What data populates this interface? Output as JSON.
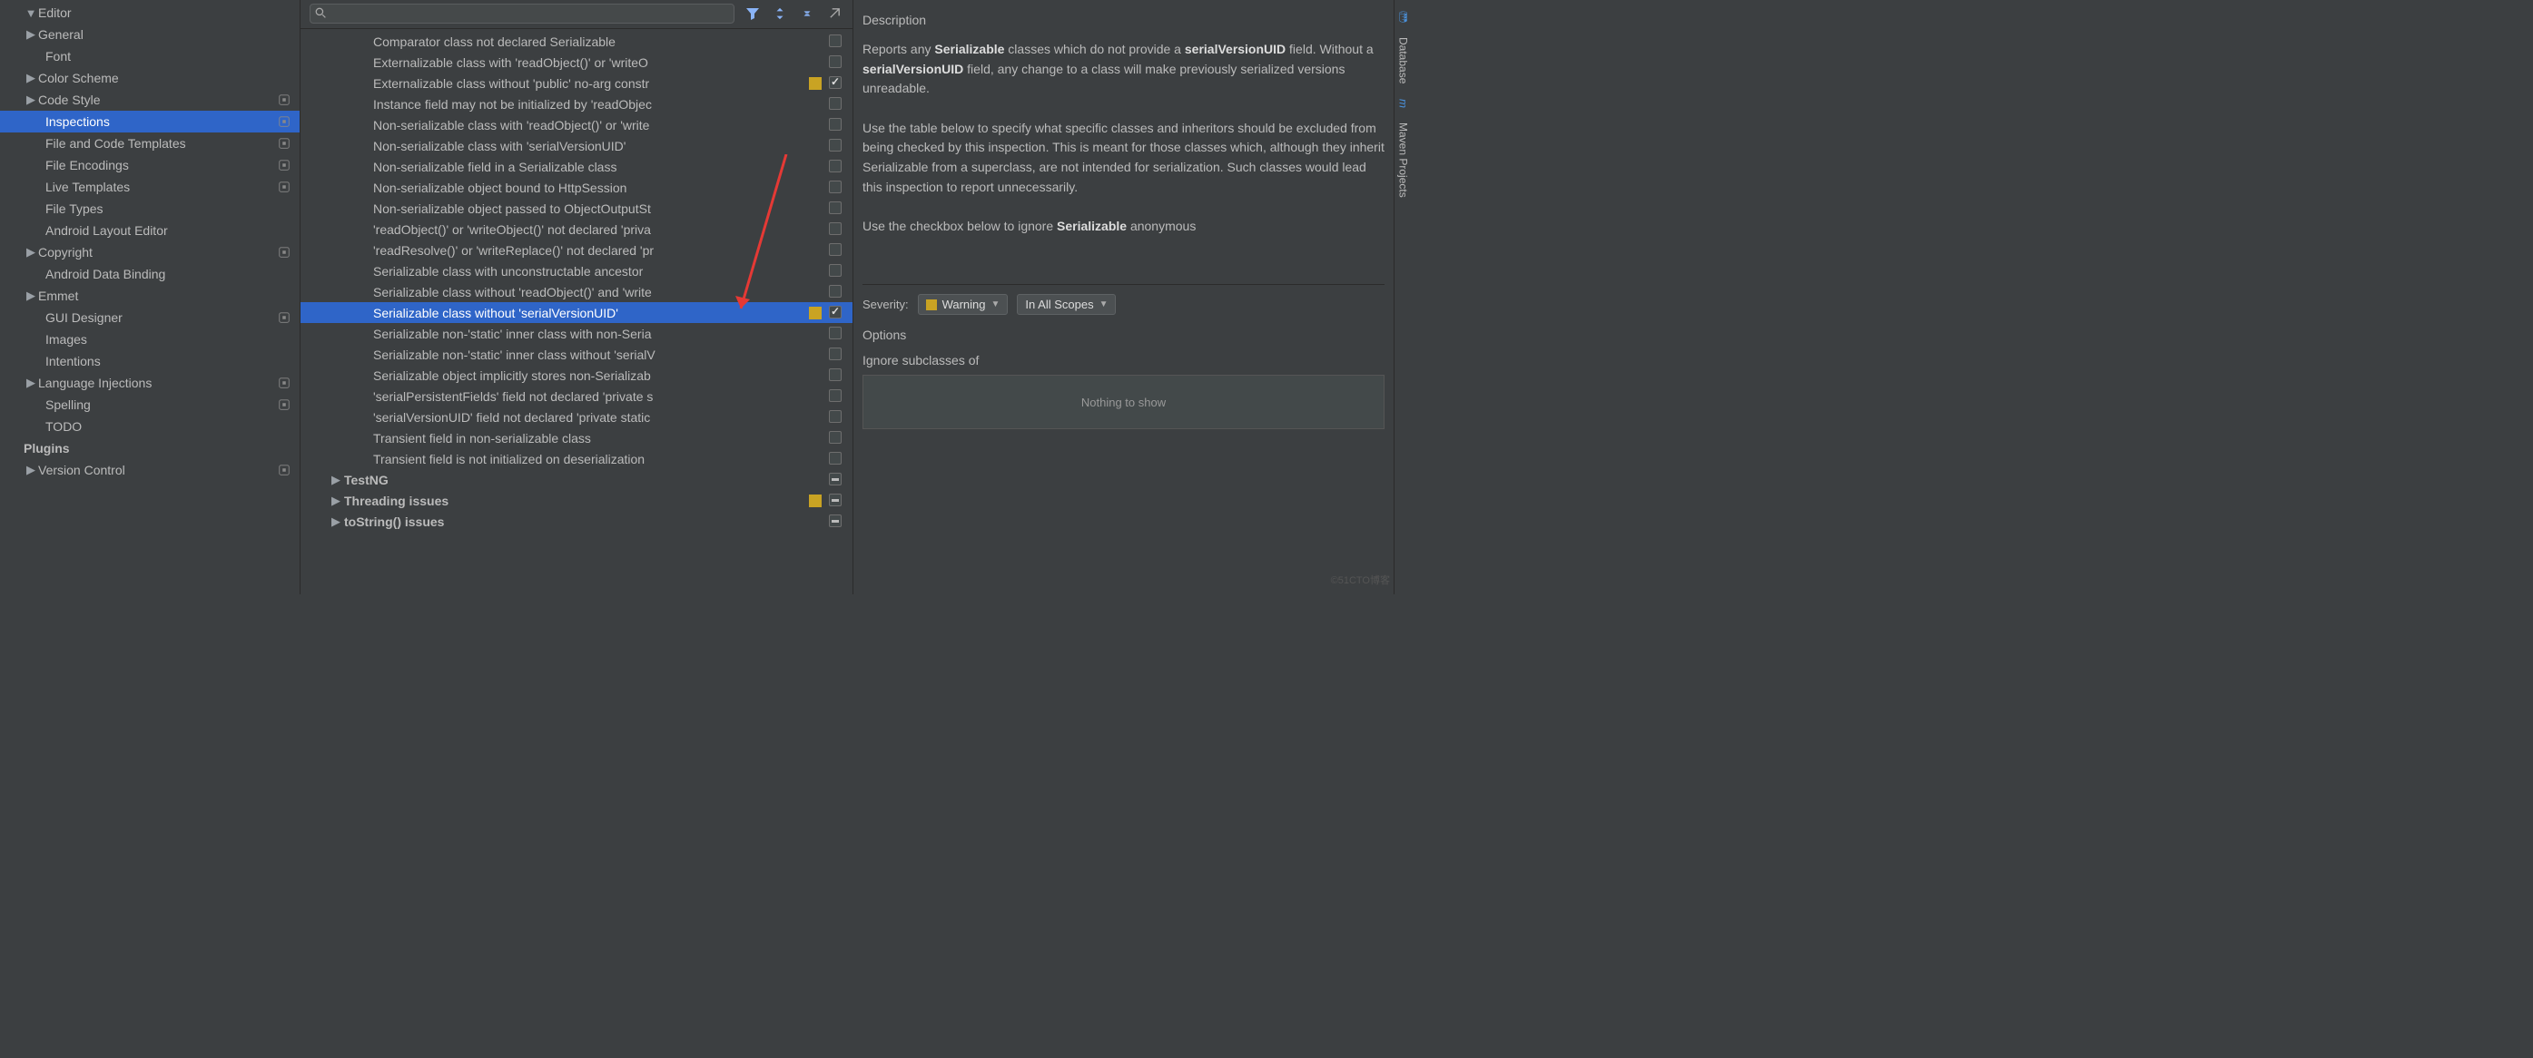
{
  "sidebar": {
    "items": [
      {
        "label": "Editor",
        "expanded": true,
        "indent": 0,
        "arrow": "▼",
        "gear": false
      },
      {
        "label": "General",
        "indent": 0,
        "arrow": "▶",
        "gear": false
      },
      {
        "label": "Font",
        "indent": 1,
        "arrow": "",
        "gear": false
      },
      {
        "label": "Color Scheme",
        "indent": 0,
        "arrow": "▶",
        "gear": false
      },
      {
        "label": "Code Style",
        "indent": 0,
        "arrow": "▶",
        "gear": true
      },
      {
        "label": "Inspections",
        "indent": 1,
        "arrow": "",
        "gear": true,
        "selected": true
      },
      {
        "label": "File and Code Templates",
        "indent": 1,
        "arrow": "",
        "gear": true
      },
      {
        "label": "File Encodings",
        "indent": 1,
        "arrow": "",
        "gear": true
      },
      {
        "label": "Live Templates",
        "indent": 1,
        "arrow": "",
        "gear": true
      },
      {
        "label": "File Types",
        "indent": 1,
        "arrow": "",
        "gear": false
      },
      {
        "label": "Android Layout Editor",
        "indent": 1,
        "arrow": "",
        "gear": false
      },
      {
        "label": "Copyright",
        "indent": 0,
        "arrow": "▶",
        "gear": true
      },
      {
        "label": "Android Data Binding",
        "indent": 1,
        "arrow": "",
        "gear": false
      },
      {
        "label": "Emmet",
        "indent": 0,
        "arrow": "▶",
        "gear": false
      },
      {
        "label": "GUI Designer",
        "indent": 1,
        "arrow": "",
        "gear": true
      },
      {
        "label": "Images",
        "indent": 1,
        "arrow": "",
        "gear": false
      },
      {
        "label": "Intentions",
        "indent": 1,
        "arrow": "",
        "gear": false
      },
      {
        "label": "Language Injections",
        "indent": 0,
        "arrow": "▶",
        "gear": true
      },
      {
        "label": "Spelling",
        "indent": 1,
        "arrow": "",
        "gear": true
      },
      {
        "label": "TODO",
        "indent": 1,
        "arrow": "",
        "gear": false
      },
      {
        "label": "Plugins",
        "indent": 0,
        "arrow": "",
        "gear": false,
        "bold": true
      },
      {
        "label": "Version Control",
        "indent": 0,
        "arrow": "▶",
        "gear": true
      }
    ]
  },
  "tree": {
    "inspections": [
      {
        "label": "Comparator class not declared Serializable",
        "cb": false
      },
      {
        "label": "Externalizable class with 'readObject()' or 'writeO",
        "cb": false
      },
      {
        "label": "Externalizable class without 'public' no-arg constr",
        "cb": true,
        "warn": true
      },
      {
        "label": "Instance field may not be initialized by 'readObjec",
        "cb": false
      },
      {
        "label": "Non-serializable class with 'readObject()' or 'write",
        "cb": false
      },
      {
        "label": "Non-serializable class with 'serialVersionUID'",
        "cb": false
      },
      {
        "label": "Non-serializable field in a Serializable class",
        "cb": false
      },
      {
        "label": "Non-serializable object bound to HttpSession",
        "cb": false
      },
      {
        "label": "Non-serializable object passed to ObjectOutputSt",
        "cb": false
      },
      {
        "label": "'readObject()' or 'writeObject()' not declared 'priva",
        "cb": false
      },
      {
        "label": "'readResolve()' or 'writeReplace()' not declared 'pr",
        "cb": false
      },
      {
        "label": "Serializable class with unconstructable ancestor",
        "cb": false
      },
      {
        "label": "Serializable class without 'readObject()' and 'write",
        "cb": false
      },
      {
        "label": "Serializable class without 'serialVersionUID'",
        "cb": true,
        "warn": true,
        "selected": true
      },
      {
        "label": "Serializable non-'static' inner class with non-Seria",
        "cb": false
      },
      {
        "label": "Serializable non-'static' inner class without 'serialV",
        "cb": false
      },
      {
        "label": "Serializable object implicitly stores non-Serializab",
        "cb": false
      },
      {
        "label": "'serialPersistentFields' field not declared 'private s",
        "cb": false
      },
      {
        "label": "'serialVersionUID' field not declared 'private static",
        "cb": false
      },
      {
        "label": "Transient field in non-serializable class",
        "cb": false
      },
      {
        "label": "Transient field is not initialized on deserialization",
        "cb": false
      }
    ],
    "groups": [
      {
        "label": "TestNG",
        "arrow": "▶",
        "mixed": true
      },
      {
        "label": "Threading issues",
        "arrow": "▶",
        "mixed": true,
        "warn": true
      },
      {
        "label": "toString() issues",
        "arrow": "▶",
        "mixed": true
      }
    ]
  },
  "desc": {
    "title": "Description",
    "p1_a": "Reports any ",
    "p1_b": "Serializable",
    "p1_c": " classes which do not provide a ",
    "p1_d": "serialVersionUID",
    "p1_e": " field. Without a ",
    "p1_f": "serialVersionUID",
    "p1_g": " field, any change to a class will make previously serialized versions unreadable.",
    "p2": "Use the table below to specify what specific classes and inheritors should be excluded from being checked by this inspection. This is meant for those classes which, although they inherit Serializable from a superclass, are not intended for serialization. Such classes would lead this inspection to report unnecessarily.",
    "p3_a": "Use the checkbox below to ignore ",
    "p3_b": "Serializable",
    "p3_c": " anonymous"
  },
  "severity": {
    "label": "Severity:",
    "value": "Warning",
    "scope": "In All Scopes"
  },
  "options": "Options",
  "sublabel": "Ignore subclasses of",
  "empty": "Nothing to show",
  "rail": {
    "db": "Database",
    "mvn": "Maven Projects"
  },
  "watermark": "©51CTO博客"
}
